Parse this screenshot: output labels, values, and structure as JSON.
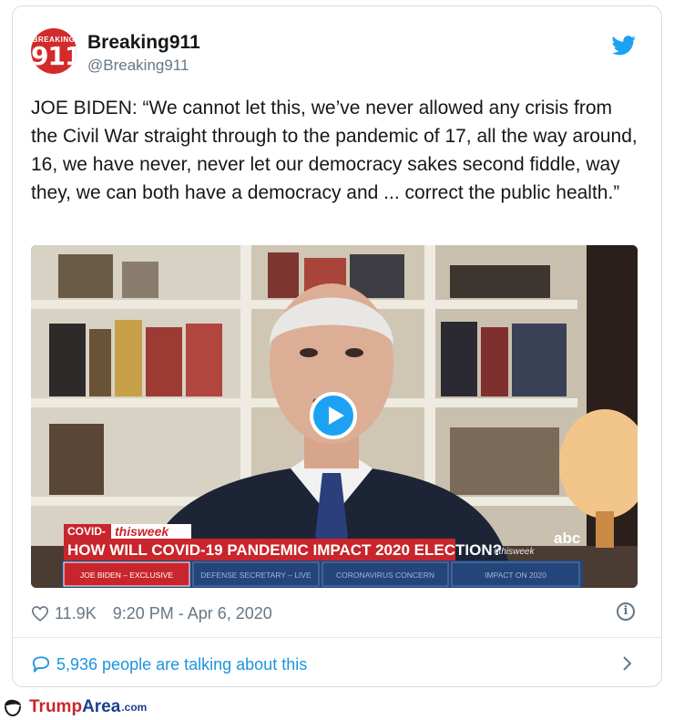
{
  "tweet": {
    "account": {
      "name": "Breaking911",
      "handle": "@Breaking911",
      "avatar_small_text": "BREAKING",
      "avatar_big_text": "911"
    },
    "text": "JOE BIDEN: “We cannot let this, we’ve never allowed any crisis from the Civil War straight through to the pandemic of 17, all the way around, 16, we have never, never let our democracy sakes second fiddle, way they, we can both have a democracy and ... correct the public health.”",
    "video": {
      "show_brand": "thisweek",
      "covid_tag": "COVID-",
      "headline": "HOW WILL COVID-19 PANDEMIC IMPACT 2020 ELECTION?",
      "watermark": "#thisweek",
      "network": "abc",
      "tabs": [
        "JOE BIDEN – EXCLUSIVE",
        "DEFENSE SECRETARY – LIVE",
        "CORONAVIRUS CONCERN",
        "IMPACT ON 2020"
      ]
    },
    "likes": "11.9K",
    "timestamp": "9:20 PM - Apr 6, 2020",
    "talking": "5,936 people are talking about this",
    "icons": {
      "platform": "twitter-bird-icon",
      "like": "heart-icon",
      "info": "info-icon",
      "reply": "speech-bubble-icon",
      "more": "chevron-right-icon",
      "play": "play-icon"
    }
  },
  "footer": {
    "brand_trump": "Trump",
    "brand_area": "Area",
    "brand_tld": ".com"
  },
  "colors": {
    "accent": "#1da1f2",
    "link": "#1b95e0",
    "text": "#14171a",
    "muted": "#657786",
    "banner_red": "#c8262c",
    "banner_blue": "#24457a"
  }
}
